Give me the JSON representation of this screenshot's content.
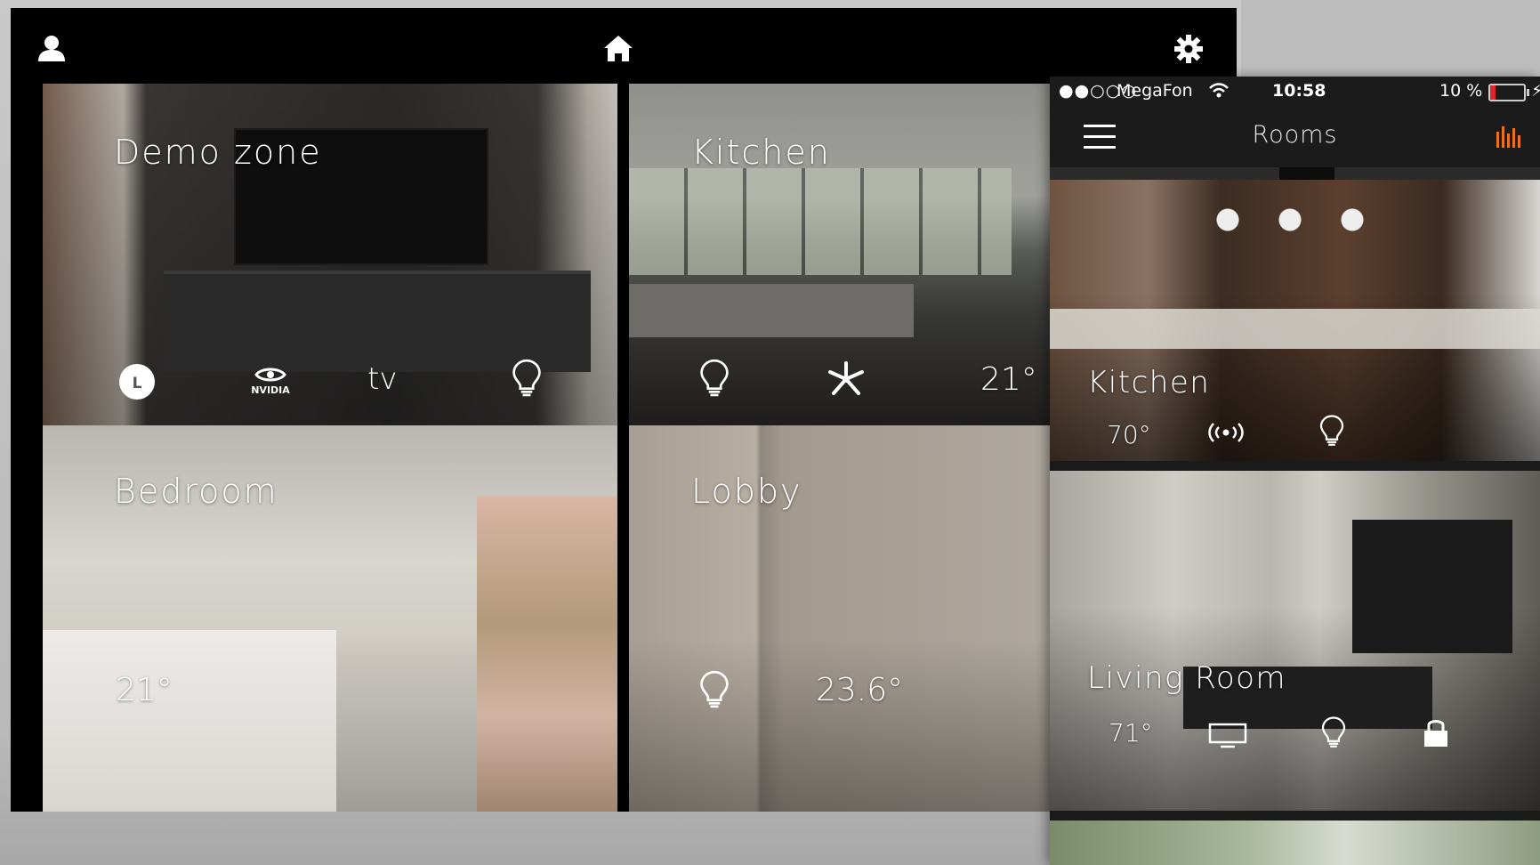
{
  "tablet": {
    "tiles": [
      {
        "title": "Demo zone",
        "devices": [
          "lg-logo",
          "nvidia-logo",
          "apple-tv-logo",
          "lightbulb-icon"
        ],
        "apple_tv_label": "tv",
        "nvidia_label": "NVIDIA"
      },
      {
        "title": "Kitchen",
        "temperature": "21°",
        "devices": [
          "lightbulb-icon",
          "fan-icon"
        ]
      },
      {
        "title": "Bedroom",
        "temperature": "21°"
      },
      {
        "title": "Lobby",
        "temperature": "23.6°",
        "devices": [
          "lightbulb-icon"
        ]
      }
    ]
  },
  "phone": {
    "status": {
      "signal": "●●○○○",
      "carrier": "MegaFon",
      "time": "10:58",
      "battery": "10 %"
    },
    "nav_title": "Rooms",
    "rooms": [
      {
        "title": "Kitchen",
        "temperature": "70°",
        "devices": [
          "wireless-icon",
          "lightbulb-icon"
        ]
      },
      {
        "title": "Living Room",
        "temperature": "71°",
        "devices": [
          "tv-icon",
          "lightbulb-icon",
          "lock-icon"
        ]
      }
    ]
  },
  "colors": {
    "accent": "#e8731a",
    "background": "#000000"
  }
}
